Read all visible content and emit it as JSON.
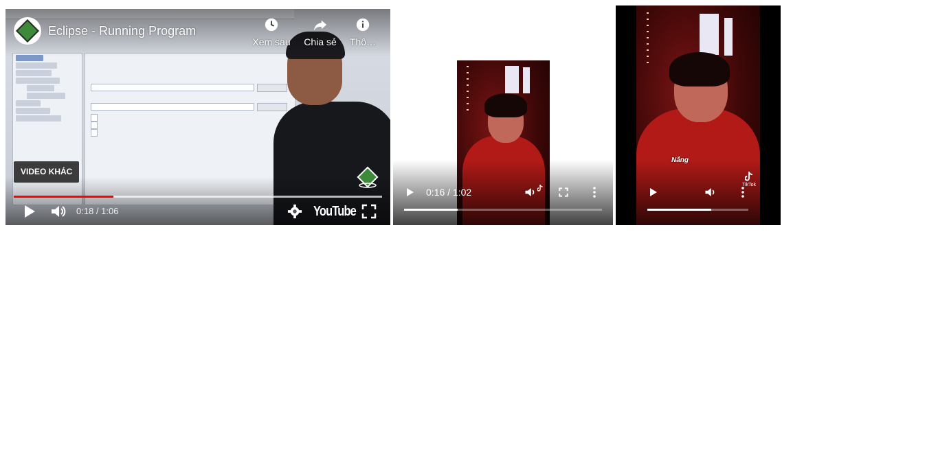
{
  "video1": {
    "title": "Eclipse - Running Program",
    "actions": [
      {
        "label": "Xem sau",
        "icon": "clock-icon"
      },
      {
        "label": "Chia sẻ",
        "icon": "share-icon"
      },
      {
        "label": "Thô…",
        "icon": "info-icon"
      }
    ],
    "more_videos_label": "VIDEO KHÁC",
    "time": "0:18 / 1:06",
    "played_fraction": 0.27,
    "loaded_fraction": 1.0,
    "brand": "YouTube",
    "colors": {
      "progress": "#ff0000"
    }
  },
  "video2": {
    "time": "0:16 / 1:02",
    "played_fraction": 0.27,
    "watermark": "TikTok"
  },
  "video3": {
    "caption": "Nắng",
    "watermark": "TikTok",
    "played_fraction": 0.63
  }
}
